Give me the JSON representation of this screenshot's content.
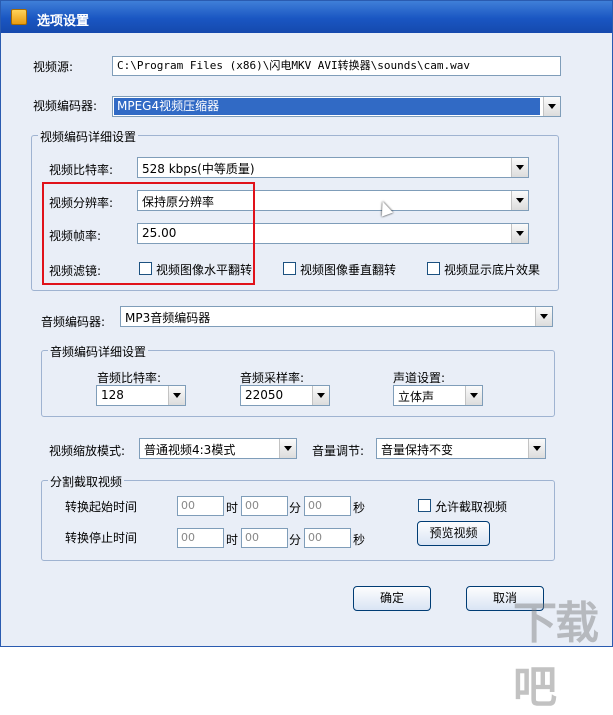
{
  "window": {
    "title": "选项设置"
  },
  "video": {
    "source_label": "视频源:",
    "source_value": "C:\\Program Files (x86)\\闪电MKV AVI转换器\\sounds\\cam.wav",
    "encoder_label": "视频编码器:",
    "encoder_value": "MPEG4视频压缩器",
    "details": {
      "title": "视频编码详细设置",
      "bitrate_label": "视频比特率:",
      "bitrate_value": "528 kbps(中等质量)",
      "resolution_label": "视频分辨率:",
      "resolution_value": "保持原分辨率",
      "framerate_label": "视频帧率:",
      "framerate_value": "25.00",
      "filter_label": "视频滤镜:",
      "filters": [
        "视频图像水平翻转",
        "视频图像垂直翻转",
        "视频显示底片效果"
      ]
    }
  },
  "audio": {
    "encoder_label": "音频编码器:",
    "encoder_value": "MP3音频编码器",
    "details": {
      "title": "音频编码详细设置",
      "bitrate_label": "音频比特率:",
      "bitrate_value": "128",
      "samplerate_label": "音频采样率:",
      "samplerate_value": "22050",
      "channel_label": "声道设置:",
      "channel_value": "立体声"
    }
  },
  "scale": {
    "mode_label": "视频缩放模式:",
    "mode_value": "普通视频4:3模式",
    "volume_label": "音量调节:",
    "volume_value": "音量保持不变"
  },
  "split": {
    "title": "分割截取视频",
    "start_label": "转换起始时间",
    "stop_label": "转换停止时间",
    "hour": "时",
    "minute": "分",
    "second": "秒",
    "placeholder": "00",
    "allow_label": "允许截取视频",
    "preview_button": "预览视频"
  },
  "buttons": {
    "ok": "确定",
    "cancel": "取消"
  },
  "watermark": "下载吧"
}
